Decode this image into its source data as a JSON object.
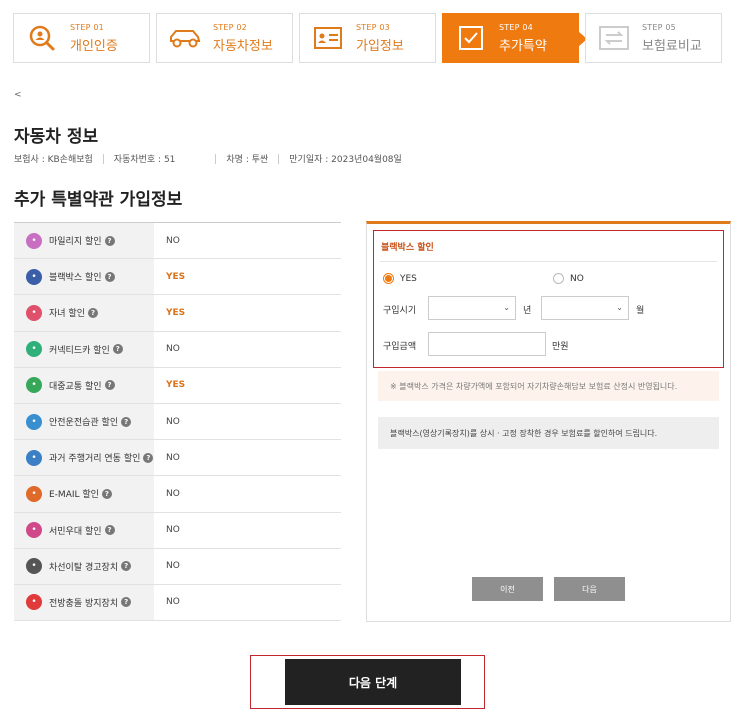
{
  "steps": [
    {
      "num": "STEP 01",
      "label": "개인인증",
      "icon": "search-person-icon",
      "state": "done"
    },
    {
      "num": "STEP 02",
      "label": "자동차정보",
      "icon": "car-icon",
      "state": "done"
    },
    {
      "num": "STEP 03",
      "label": "가입정보",
      "icon": "id-card-icon",
      "state": "done"
    },
    {
      "num": "STEP 04",
      "label": "추가특약",
      "icon": "checkbox-icon",
      "state": "active"
    },
    {
      "num": "STEP 05",
      "label": "보험료비교",
      "icon": "compare-arrows-icon",
      "state": "disabled"
    }
  ],
  "back_label": "<",
  "car_info": {
    "title": "자동차 정보",
    "insurer": "보험사 : KB손해보험",
    "car_number": "자동차번호 : 51",
    "car_model": "차명 : 투싼",
    "expiry": "만기일자 : 2023년04월08일"
  },
  "special_title": "추가 특별약관 가입정보",
  "options": [
    {
      "label": "마일리지 할인",
      "value": "NO",
      "icon": "mileage-icon",
      "color": "#c86fc2"
    },
    {
      "label": "블랙박스 할인",
      "value": "YES",
      "icon": "blackbox-icon",
      "color": "#3a5fa8"
    },
    {
      "label": "자녀 할인",
      "value": "YES",
      "icon": "child-icon",
      "color": "#e0506b"
    },
    {
      "label": "커넥티드카 할인",
      "value": "NO",
      "icon": "connected-car-icon",
      "color": "#2fb07a"
    },
    {
      "label": "대중교통 할인",
      "value": "YES",
      "icon": "bus-icon",
      "color": "#37a85a"
    },
    {
      "label": "안전운전습관 할인",
      "value": "NO",
      "icon": "safe-driving-icon",
      "color": "#3a8fd0"
    },
    {
      "label": "과거 주행거리 연동 할인",
      "value": "NO",
      "icon": "odometer-icon",
      "color": "#3b7fc4"
    },
    {
      "label": "E-MAIL 할인",
      "value": "NO",
      "icon": "email-icon",
      "color": "#e06a2a"
    },
    {
      "label": "서민우대 할인",
      "value": "NO",
      "icon": "house-icon",
      "color": "#d04a8a"
    },
    {
      "label": "차선이탈 경고장치",
      "value": "NO",
      "icon": "lane-warning-icon",
      "color": "#555555"
    },
    {
      "label": "전방충돌 방지장치",
      "value": "NO",
      "icon": "collision-icon",
      "color": "#e03a3a"
    }
  ],
  "panel": {
    "title": "블랙박스 할인",
    "yes_label": "YES",
    "no_label": "NO",
    "purchase_date_label": "구입시기",
    "year_unit": "년",
    "month_unit": "월",
    "purchase_price_label": "구입금액",
    "price_unit": "만원",
    "year_value": "",
    "month_value": "",
    "price_value": "",
    "notice": "※ 블랙박스 가격은 차량가액에 포함되어 자기차량손해담보 보험료 산정시 반영됩니다.",
    "description": "블랙박스(영상기록장치)를 상시 · 고정 장착한 경우 보험료를 할인하여 드립니다.",
    "prev_label": "이전",
    "next_label": "다음"
  },
  "next_step_label": "다음 단계",
  "colors": {
    "accent": "#ef7a10",
    "dark": "#222222",
    "highlight_red": "#c4262e"
  }
}
